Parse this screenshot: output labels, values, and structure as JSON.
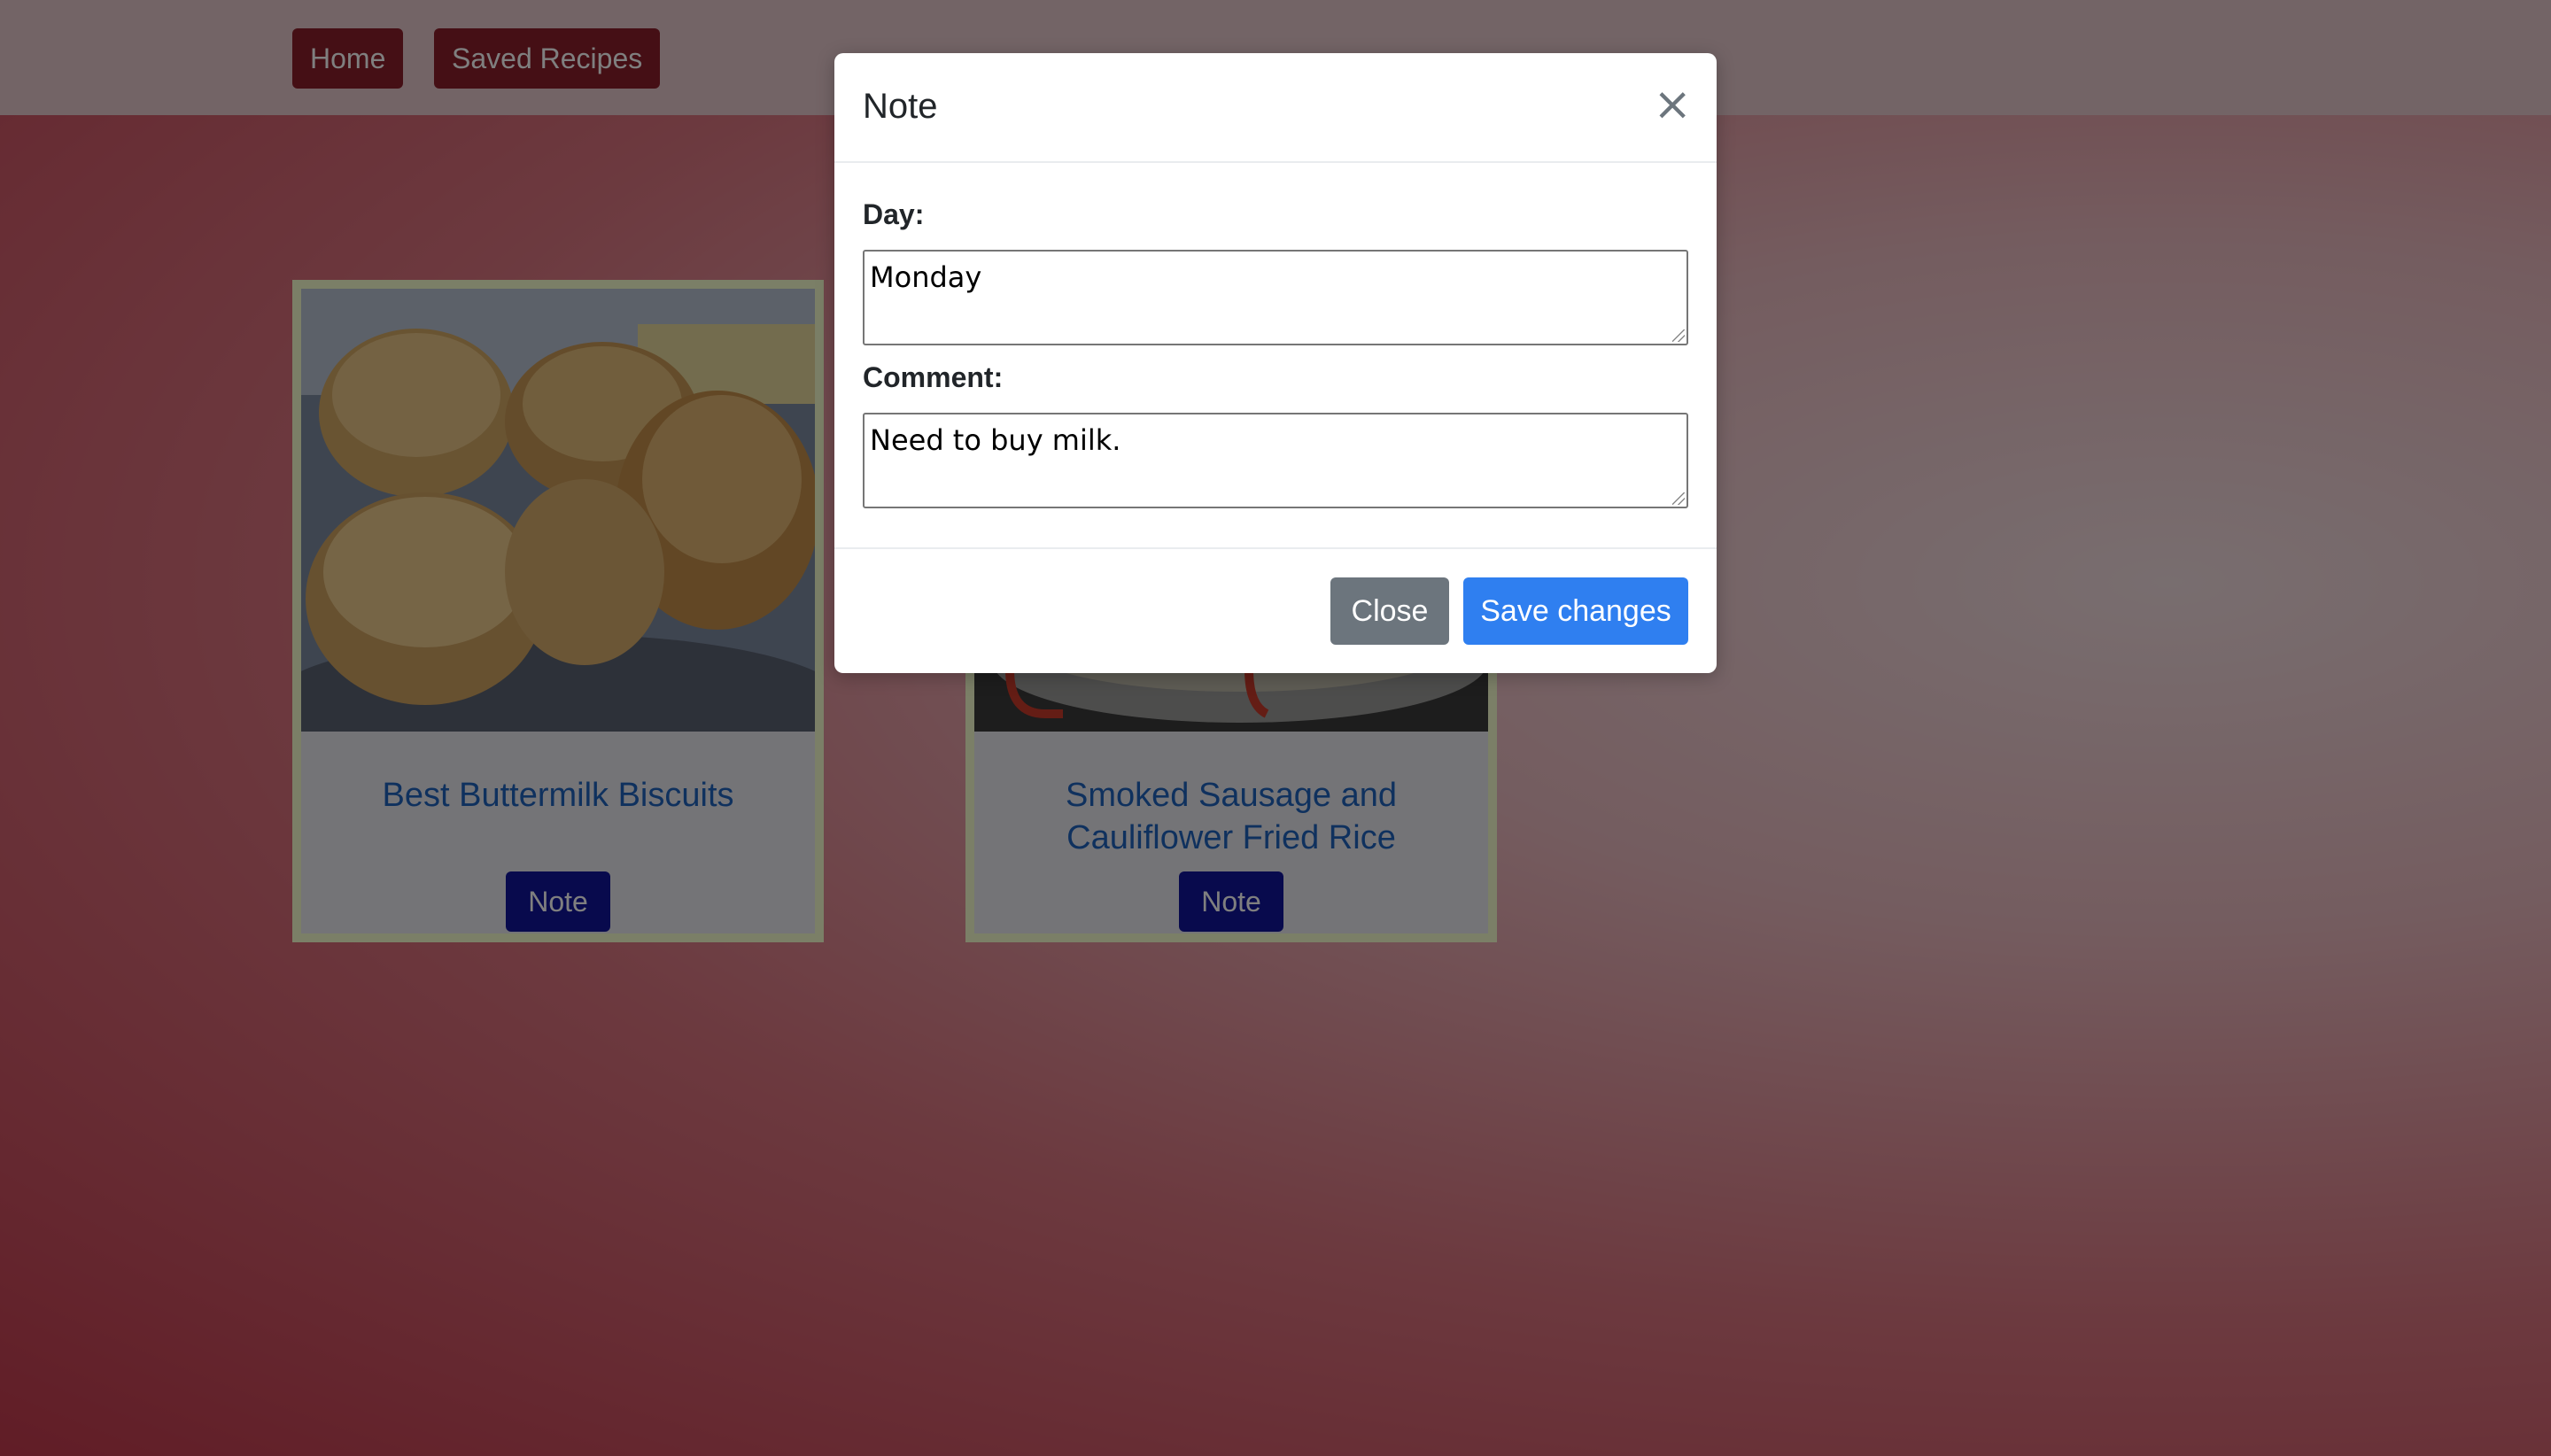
{
  "nav": {
    "home_label": "Home",
    "saved_label": "Saved Recipes"
  },
  "cards": [
    {
      "title": "Best Buttermilk Biscuits",
      "note_label": "Note"
    },
    {
      "title": "Smoked Sausage and Cauliflower Fried Rice",
      "note_label": "Note"
    }
  ],
  "modal": {
    "title": "Note",
    "close_symbol": "×",
    "day_label": "Day:",
    "day_value": "Monday",
    "comment_label": "Comment:",
    "comment_value": "Need to buy milk.",
    "close_button": "Close",
    "save_button": "Save changes"
  },
  "colors": {
    "nav_button": "#8a1f2a",
    "note_button": "#10149a",
    "recipe_title": "#1f62bd",
    "save_button": "#2f7ff0",
    "close_button": "#6c757d",
    "card_border": "#f6ffcf"
  }
}
